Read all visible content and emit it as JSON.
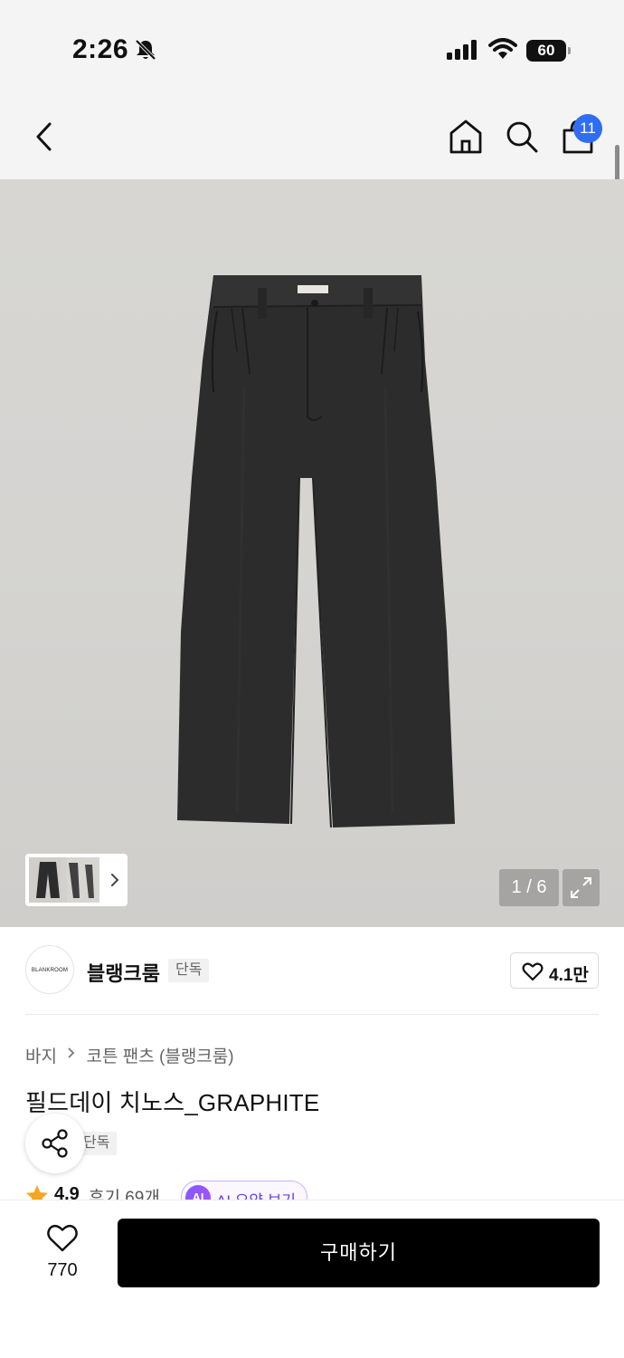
{
  "status_bar": {
    "time": "2:26",
    "battery": "60"
  },
  "header": {
    "cart_count": "11"
  },
  "gallery": {
    "page_indicator": "1 / 6"
  },
  "brand": {
    "logo_text": "BLANKROOM",
    "name": "블랭크룸",
    "tag": "단독",
    "like_count": "4.1만"
  },
  "product": {
    "breadcrumb": [
      "바지",
      "코튼 팬츠 (블랭크룸)"
    ],
    "title": "필드데이 치노스_GRAPHITE",
    "tag": "단독",
    "rating": "4.9",
    "review_count": "후기 69개",
    "ai_badge": "AI",
    "ai_summary_label": "AI 요약 보기"
  },
  "bottom_bar": {
    "wish_count": "770",
    "buy_label": "구매하기"
  },
  "colors": {
    "accent_blue": "#2f6ef2",
    "star": "#f5a623",
    "ai_purple": "#6a3fe0"
  }
}
